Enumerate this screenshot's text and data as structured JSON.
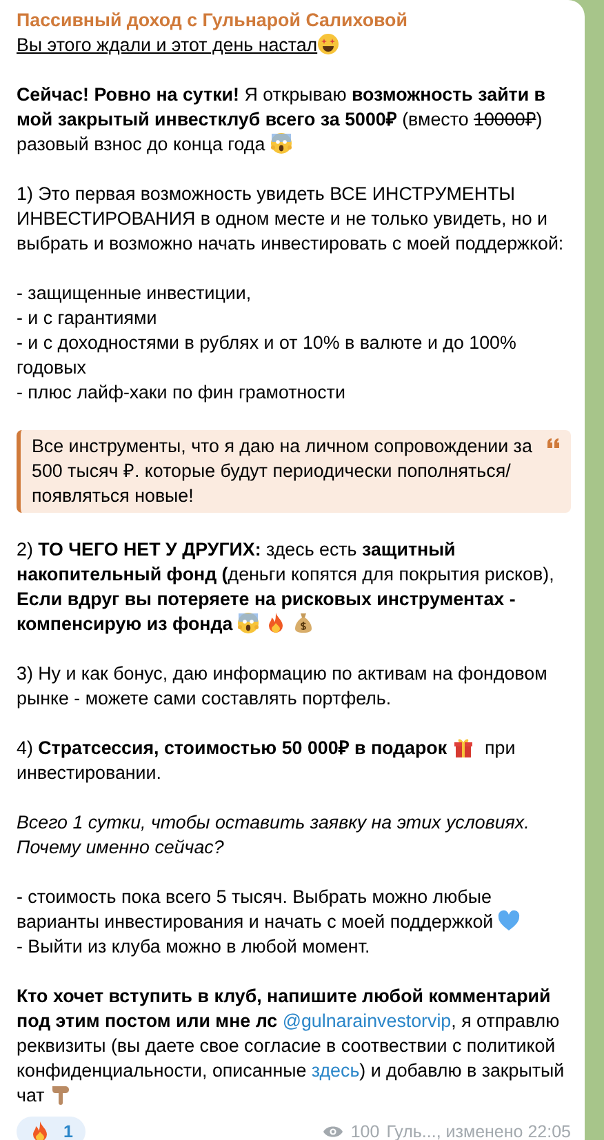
{
  "message": {
    "author": "Пассивный доход с Гульнарой Салиховой",
    "blocks": [
      {
        "kind": "para",
        "parts": [
          {
            "kind": "underline",
            "text": "Вы этого ждали и этот день настал"
          },
          {
            "kind": "starstruck"
          }
        ]
      },
      {
        "kind": "para",
        "parts": [
          {
            "kind": "text",
            "text": "**Сейчас! Ровно на сутки!** Я открываю **возможность зайти в мой закрытый инвестклуб всего за 5000₽** (вместо "
          },
          {
            "kind": "strike",
            "text": "10000₽"
          },
          {
            "kind": "text",
            "text": ") разовый взнос до конца года "
          },
          {
            "kind": "scream"
          }
        ]
      },
      {
        "kind": "para",
        "parts": [
          {
            "kind": "text",
            "text": "1) Это первая возможность увидеть ВСЕ ИНСТРУМЕНТЫ ИНВЕСТИРОВАНИЯ в одном месте и не только увидеть, но и выбрать и возможно начать инвестировать с моей поддержкой:"
          }
        ]
      },
      {
        "kind": "para",
        "parts": [
          {
            "kind": "text",
            "text": "- защищенные инвестиции,\n- и с гарантиями\n- и с доходностями в рублях и от 10% в валюте и до 100% годовых\n- плюс лайф-хаки по фин грамотности"
          }
        ]
      },
      {
        "kind": "quote",
        "parts": [
          {
            "kind": "text",
            "text": "Все инструменты, что я даю на личном сопровождении за 500 тысяч ₽. которые будут периодически пополняться/появляться новые!"
          }
        ]
      },
      {
        "kind": "para",
        "parts": [
          {
            "kind": "text",
            "text": "2) **ТО ЧЕГО НЕТ У ДРУГИХ:** здесь есть **защитный накопительный фонд (**деньги копятся для покрытия рисков), **Если вдруг вы потеряете на рисковых инструментах - компенсирую из фонда** "
          },
          {
            "kind": "scream"
          },
          {
            "kind": "fire"
          },
          {
            "kind": "moneybag"
          }
        ]
      },
      {
        "kind": "para",
        "parts": [
          {
            "kind": "text",
            "text": "3) Ну и как бонус, даю информацию по активам на фондовом рынке - можете сами составлять портфель."
          }
        ]
      },
      {
        "kind": "para",
        "parts": [
          {
            "kind": "text",
            "text": "4) **Стратсессия, стоимостью 50 000₽ в подарок** "
          },
          {
            "kind": "gift"
          },
          {
            "kind": "text",
            "text": " при инвестировании."
          }
        ]
      },
      {
        "kind": "italic",
        "parts": [
          {
            "kind": "text",
            "text": "Всего 1 сутки, чтобы оставить заявку на этих условиях. Почему именно сейчас?"
          }
        ]
      },
      {
        "kind": "para",
        "parts": [
          {
            "kind": "text",
            "text": "- стоимость пока всего 5 тысяч. Выбрать можно любые варианты инвестирования и начать с моей поддержкой "
          },
          {
            "kind": "heart"
          },
          {
            "kind": "text",
            "text": "\n- Выйти из клуба можно в любой момент."
          }
        ]
      },
      {
        "kind": "para",
        "parts": [
          {
            "kind": "text",
            "text": "**Кто хочет вступить в клуб, напишите любой комментарий под этим постом или мне лс** "
          },
          {
            "kind": "link",
            "text": "@gulnarainvestorvip"
          },
          {
            "kind": "text",
            "text": ", я отправлю реквизиты (вы даете свое согласие в соотвествии с политикой конфиденциальности, описанные "
          },
          {
            "kind": "link",
            "text": "здесь"
          },
          {
            "kind": "text",
            "text": ") и добавлю в закрытый чат "
          },
          {
            "kind": "pointdown"
          }
        ]
      }
    ],
    "reaction": {
      "kind": "fire",
      "count": "1",
      "selected": false
    },
    "views": "100",
    "meta": "Гуль..., изменено 22:05"
  }
}
